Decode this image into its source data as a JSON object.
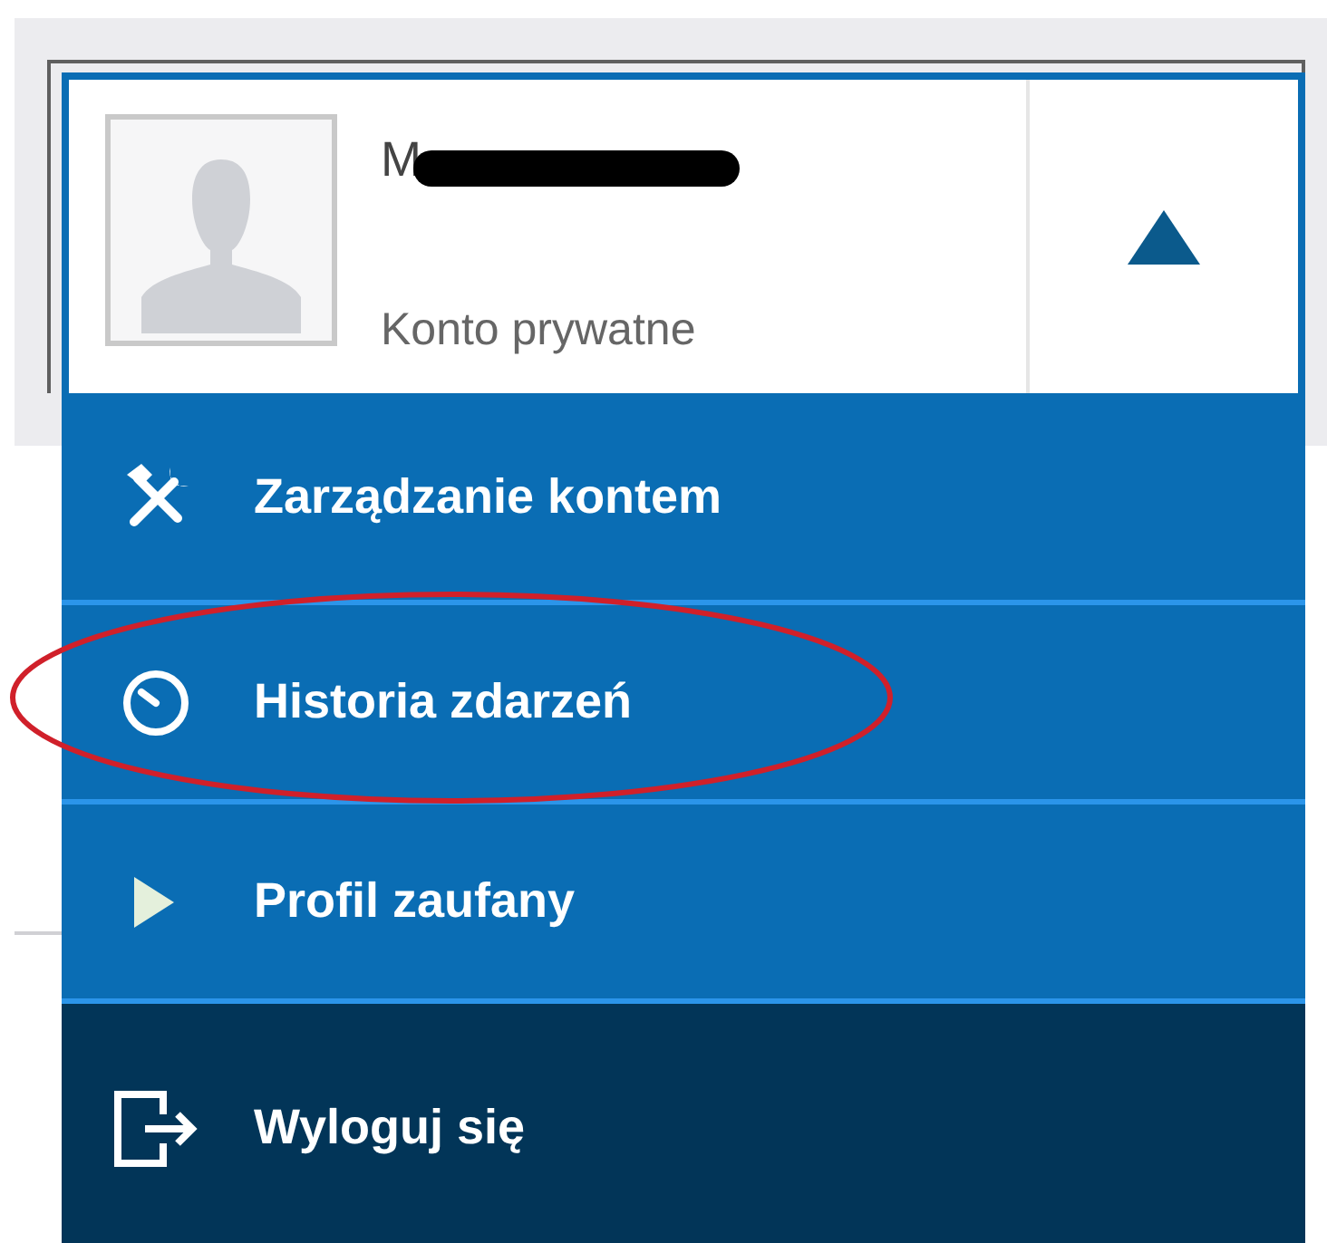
{
  "account": {
    "name": "M",
    "name_redacted": true,
    "type": "Konto prywatne",
    "expanded": true
  },
  "menu": [
    {
      "label": "Zarządzanie kontem",
      "kind": "tools",
      "circled": false
    },
    {
      "label": "Historia zdarzeń",
      "kind": "clock",
      "circled": true
    },
    {
      "label": "Profil zaufany",
      "kind": "play",
      "circled": false
    },
    {
      "label": "Wyloguj się",
      "kind": "logout",
      "circled": false
    }
  ]
}
